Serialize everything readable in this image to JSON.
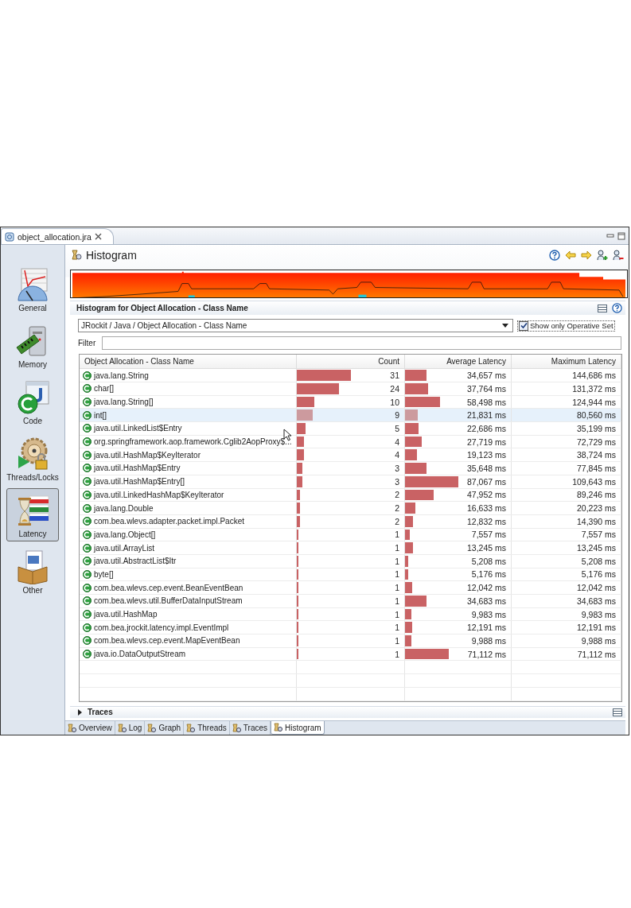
{
  "editor_tab": {
    "title": "object_allocation.jra",
    "selected": true
  },
  "sidebar": {
    "items": [
      {
        "label": "General",
        "kind": "general",
        "selected": false
      },
      {
        "label": "Memory",
        "kind": "memory",
        "selected": false
      },
      {
        "label": "Code",
        "kind": "code",
        "selected": false
      },
      {
        "label": "Threads/Locks",
        "kind": "threads",
        "selected": false
      },
      {
        "label": "Latency",
        "kind": "latency",
        "selected": true
      },
      {
        "label": "Other",
        "kind": "other",
        "selected": false
      }
    ]
  },
  "page": {
    "title": "Histogram"
  },
  "histogram": {
    "title": "Histogram for Object Allocation - Class Name",
    "selector": {
      "value": "JRockit / Java / Object Allocation - Class Name"
    },
    "operative_set": {
      "label": "Show only Operative Set",
      "checked": true
    },
    "filter": {
      "label": "Filter"
    },
    "table": {
      "columns": [
        "Object Allocation - Class Name",
        "Count",
        "Average Latency",
        "Maximum Latency"
      ],
      "rows": [
        {
          "name": "java.lang.String",
          "count": {
            "text": "31",
            "level": 0.5
          },
          "average": {
            "text": "34,657 ms",
            "level": 0.2
          },
          "maximum": "144,686 ms",
          "selected": false
        },
        {
          "name": "char[]",
          "count": {
            "text": "24",
            "level": 0.39
          },
          "average": {
            "text": "37,764 ms",
            "level": 0.22
          },
          "maximum": "131,372 ms",
          "selected": false
        },
        {
          "name": "java.lang.String[]",
          "count": {
            "text": "10",
            "level": 0.16
          },
          "average": {
            "text": "58,498 ms",
            "level": 0.33
          },
          "maximum": "124,944 ms",
          "selected": false
        },
        {
          "name": "int[]",
          "count": {
            "text": "9",
            "level": 0.15
          },
          "average": {
            "text": "21,831 ms",
            "level": 0.12
          },
          "maximum": "80,560 ms",
          "selected": true
        },
        {
          "name": "java.util.LinkedList$Entry",
          "count": {
            "text": "5",
            "level": 0.08
          },
          "average": {
            "text": "22,686 ms",
            "level": 0.13
          },
          "maximum": "35,199 ms",
          "selected": false
        },
        {
          "name": "org.springframework.aop.framework.Cglib2AopProxy$...",
          "count": {
            "text": "4",
            "level": 0.065
          },
          "average": {
            "text": "27,719 ms",
            "level": 0.16
          },
          "maximum": "72,729 ms",
          "selected": false
        },
        {
          "name": "java.util.HashMap$KeyIterator",
          "count": {
            "text": "4",
            "level": 0.065
          },
          "average": {
            "text": "19,123 ms",
            "level": 0.11
          },
          "maximum": "38,724 ms",
          "selected": false
        },
        {
          "name": "java.util.HashMap$Entry",
          "count": {
            "text": "3",
            "level": 0.05
          },
          "average": {
            "text": "35,648 ms",
            "level": 0.2
          },
          "maximum": "77,845 ms",
          "selected": false
        },
        {
          "name": "java.util.HashMap$Entry[]",
          "count": {
            "text": "3",
            "level": 0.05
          },
          "average": {
            "text": "87,067 ms",
            "level": 0.5
          },
          "maximum": "109,643 ms",
          "selected": false
        },
        {
          "name": "java.util.LinkedHashMap$KeyIterator",
          "count": {
            "text": "2",
            "level": 0.03
          },
          "average": {
            "text": "47,952 ms",
            "level": 0.27
          },
          "maximum": "89,246 ms",
          "selected": false
        },
        {
          "name": "java.lang.Double",
          "count": {
            "text": "2",
            "level": 0.03
          },
          "average": {
            "text": "16,633 ms",
            "level": 0.095
          },
          "maximum": "20,223 ms",
          "selected": false
        },
        {
          "name": "com.bea.wlevs.adapter.packet.impl.Packet",
          "count": {
            "text": "2",
            "level": 0.03
          },
          "average": {
            "text": "12,832 ms",
            "level": 0.073
          },
          "maximum": "14,390 ms",
          "selected": false
        },
        {
          "name": "java.lang.Object[]",
          "count": {
            "text": "1",
            "level": 0.015
          },
          "average": {
            "text": "7,557 ms",
            "level": 0.043
          },
          "maximum": "7,557 ms",
          "selected": false
        },
        {
          "name": "java.util.ArrayList",
          "count": {
            "text": "1",
            "level": 0.015
          },
          "average": {
            "text": "13,245 ms",
            "level": 0.076
          },
          "maximum": "13,245 ms",
          "selected": false
        },
        {
          "name": "java.util.AbstractList$Itr",
          "count": {
            "text": "1",
            "level": 0.015
          },
          "average": {
            "text": "5,208 ms",
            "level": 0.03
          },
          "maximum": "5,208 ms",
          "selected": false
        },
        {
          "name": "byte[]",
          "count": {
            "text": "1",
            "level": 0.015
          },
          "average": {
            "text": "5,176 ms",
            "level": 0.03
          },
          "maximum": "5,176 ms",
          "selected": false
        },
        {
          "name": "com.bea.wlevs.cep.event.BeanEventBean",
          "count": {
            "text": "1",
            "level": 0.015
          },
          "average": {
            "text": "12,042 ms",
            "level": 0.069
          },
          "maximum": "12,042 ms",
          "selected": false
        },
        {
          "name": "com.bea.wlevs.util.BufferDataInputStream",
          "count": {
            "text": "1",
            "level": 0.015
          },
          "average": {
            "text": "34,683 ms",
            "level": 0.2
          },
          "maximum": "34,683 ms",
          "selected": false
        },
        {
          "name": "java.util.HashMap",
          "count": {
            "text": "1",
            "level": 0.015
          },
          "average": {
            "text": "9,983 ms",
            "level": 0.057
          },
          "maximum": "9,983 ms",
          "selected": false
        },
        {
          "name": "com.bea.jrockit.latency.impl.EventImpl",
          "count": {
            "text": "1",
            "level": 0.015
          },
          "average": {
            "text": "12,191 ms",
            "level": 0.07
          },
          "maximum": "12,191 ms",
          "selected": false
        },
        {
          "name": "com.bea.wlevs.cep.event.MapEventBean",
          "count": {
            "text": "1",
            "level": 0.015
          },
          "average": {
            "text": "9,988 ms",
            "level": 0.057
          },
          "maximum": "9,988 ms",
          "selected": false
        },
        {
          "name": "java.io.DataOutputStream",
          "count": {
            "text": "1",
            "level": 0.015
          },
          "average": {
            "text": "71,112 ms",
            "level": 0.41
          },
          "maximum": "71,112 ms",
          "selected": false
        }
      ]
    }
  },
  "traces": {
    "title": "Traces",
    "expanded": false
  },
  "bottom_tabs": [
    {
      "label": "Overview",
      "selected": false
    },
    {
      "label": "Log",
      "selected": false
    },
    {
      "label": "Graph",
      "selected": false
    },
    {
      "label": "Threads",
      "selected": false
    },
    {
      "label": "Traces",
      "selected": false
    },
    {
      "label": "Histogram",
      "selected": true
    }
  ]
}
